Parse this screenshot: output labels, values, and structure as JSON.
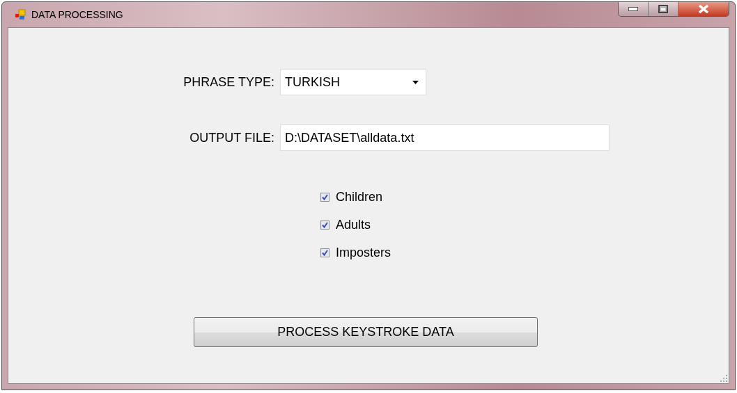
{
  "window": {
    "title": "DATA PROCESSING"
  },
  "phrase_type": {
    "label": "PHRASE TYPE:",
    "value": "TURKISH"
  },
  "output_file": {
    "label": "OUTPUT FILE:",
    "value": "D:\\DATASET\\alldata.txt"
  },
  "checkboxes": [
    {
      "label": "Children",
      "checked": true
    },
    {
      "label": "Adults",
      "checked": true
    },
    {
      "label": "Imposters",
      "checked": true
    }
  ],
  "button": {
    "label": "PROCESS KEYSTROKE DATA"
  }
}
